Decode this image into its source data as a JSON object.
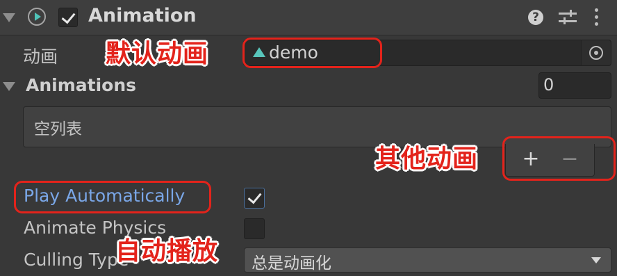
{
  "header": {
    "title": "Animation",
    "enabled": true,
    "icons": [
      "fold-arrow",
      "animation-component-icon",
      "enable-checkbox",
      "help-icon",
      "presets-icon",
      "context-menu-icon"
    ]
  },
  "fields": {
    "default_animation": {
      "label": "动画",
      "value": "demo"
    },
    "animations": {
      "label": "Animations",
      "size": "0",
      "empty_text": "空列表"
    },
    "play_automatically": {
      "label": "Play Automatically",
      "checked": true
    },
    "animate_physics": {
      "label": "Animate Physics",
      "checked": false
    },
    "culling_type": {
      "label": "Culling Type",
      "value": "总是动画化"
    }
  },
  "list_buttons": {
    "add": "+",
    "remove": "−"
  },
  "annotations": {
    "default_animation": "默认动画",
    "other_animations": "其他动画",
    "auto_play": "自动播放"
  },
  "colors": {
    "background": "#383838",
    "header": "#3e3e3e",
    "accent_blue": "#7aa7e8",
    "annotation_red": "#e3231b",
    "animation_teal": "#58c5bb"
  }
}
